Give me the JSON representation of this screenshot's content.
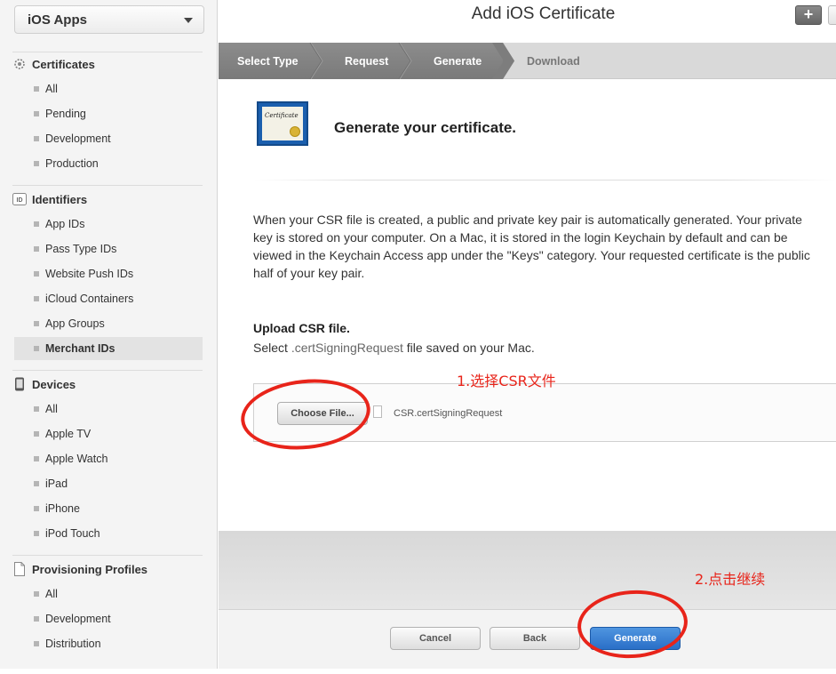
{
  "sidebar": {
    "app_select": "iOS Apps",
    "sections": [
      {
        "title": "Certificates",
        "icon": "certificate-icon",
        "items": [
          "All",
          "Pending",
          "Development",
          "Production"
        ]
      },
      {
        "title": "Identifiers",
        "icon": "id-icon",
        "items": [
          "App IDs",
          "Pass Type IDs",
          "Website Push IDs",
          "iCloud Containers",
          "App Groups",
          "Merchant IDs"
        ]
      },
      {
        "title": "Devices",
        "icon": "device-icon",
        "items": [
          "All",
          "Apple TV",
          "Apple Watch",
          "iPad",
          "iPhone",
          "iPod Touch"
        ]
      },
      {
        "title": "Provisioning Profiles",
        "icon": "document-icon",
        "items": [
          "All",
          "Development",
          "Distribution"
        ]
      }
    ],
    "selected_item": "Merchant IDs"
  },
  "main": {
    "title": "Add iOS Certificate",
    "steps": [
      "Select Type",
      "Request",
      "Generate",
      "Download"
    ],
    "current_step": "Generate",
    "heading": "Generate your certificate.",
    "cert_icon_text": "Certificate",
    "description": "When your CSR file is created, a public and private key pair is automatically generated. Your private key is stored on your computer. On a Mac, it is stored in the login Keychain by default and can be viewed in the Keychain Access app under the \"Keys\" category. Your requested certificate is the public half of your key pair.",
    "upload_title": "Upload CSR file.",
    "upload_sub_prefix": "Select ",
    "upload_sub_ext": ".certSigningRequest",
    "upload_sub_suffix": " file saved on your Mac.",
    "choose_file_label": "Choose File...",
    "file_name": "CSR.certSigningRequest",
    "buttons": {
      "cancel": "Cancel",
      "back": "Back",
      "generate": "Generate"
    }
  },
  "annotations": {
    "step1": "1.选择CSR文件",
    "step2": "2.点击继续",
    "color": "#e8241a"
  }
}
